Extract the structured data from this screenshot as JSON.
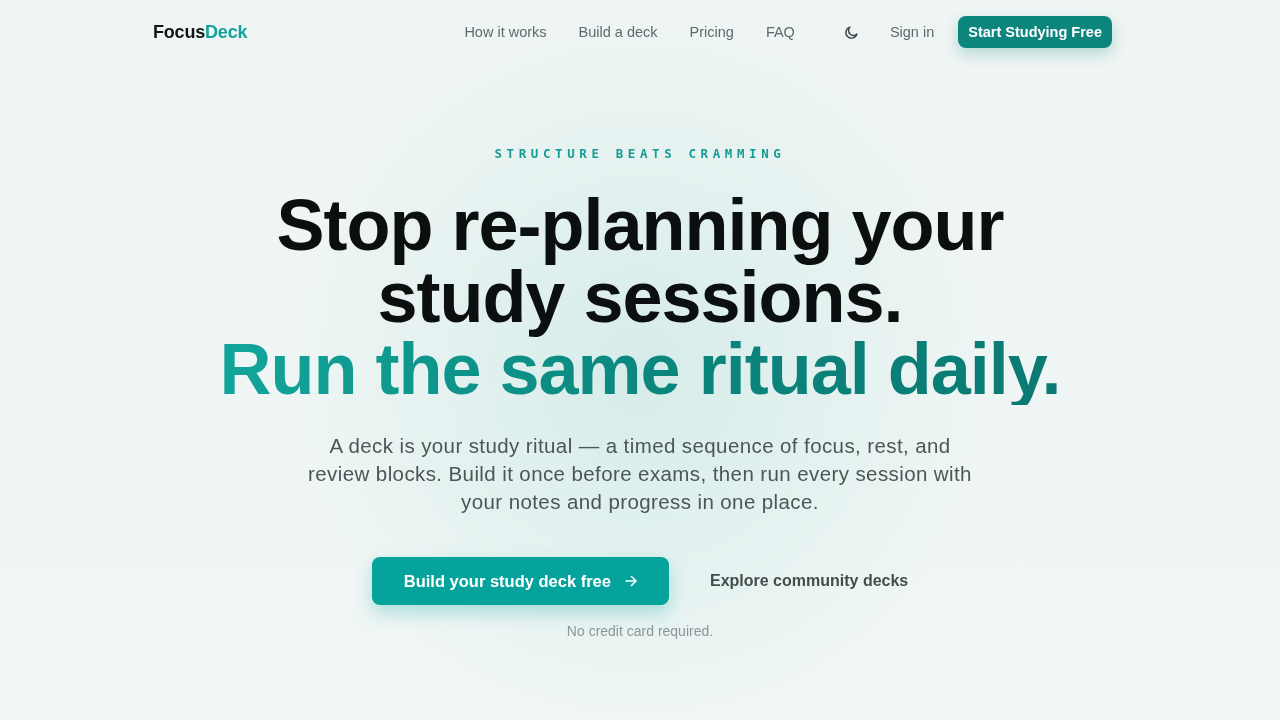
{
  "nav": {
    "logo": {
      "text": "Focus",
      "accent": "Deck"
    },
    "links": [
      {
        "label": "How it works"
      },
      {
        "label": "Build a deck"
      },
      {
        "label": "Pricing"
      },
      {
        "label": "FAQ"
      }
    ],
    "sign_in": "Sign in",
    "cta": "Start Studying Free"
  },
  "hero": {
    "eyebrow": "STRUCTURE BEATS CRAMMING",
    "headline": "Stop re-planning your study sessions.",
    "headline_accent": "Run the same ritual daily.",
    "description": "A deck is your study ritual — a timed sequence of focus, rest, and review blocks. Build it once before exams, then run every session with your notes and progress in one place.",
    "primary_button": "Build your study deck free",
    "secondary_link": "Explore community decks",
    "note": "No credit card required."
  }
}
